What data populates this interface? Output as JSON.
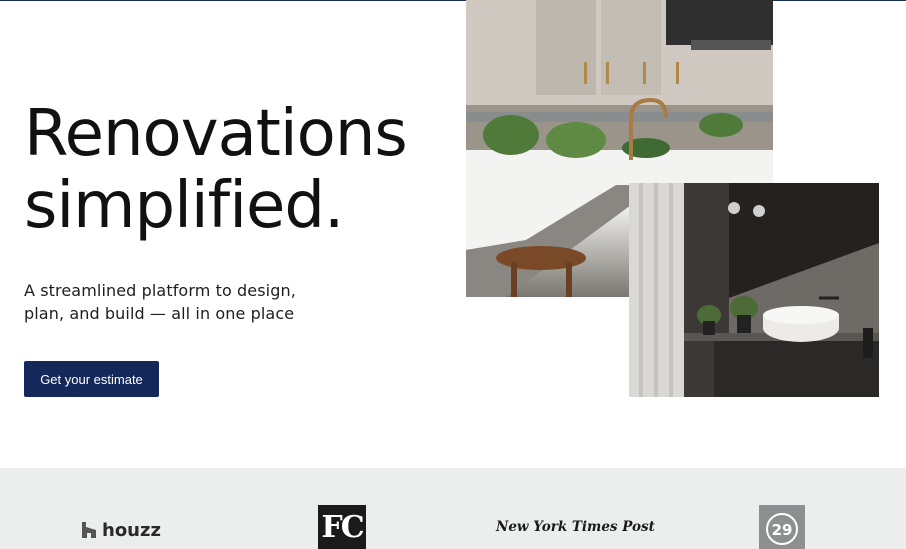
{
  "hero": {
    "title_line1": "Renovations",
    "title_line2": "simplified.",
    "subtitle": "A streamlined platform to design, plan, and build — all in one place",
    "cta_label": "Get your estimate"
  },
  "images": {
    "kitchen": "kitchen-photo",
    "bathroom": "bathroom-photo"
  },
  "press": {
    "logos": [
      {
        "name": "houzz",
        "text": "houzz"
      },
      {
        "name": "fc",
        "text": "FC"
      },
      {
        "name": "nytp",
        "text": "New York Times Post"
      },
      {
        "name": "d29",
        "text": "29"
      }
    ]
  },
  "colors": {
    "primary": "#14295a",
    "press_bg": "#ebeeed"
  }
}
